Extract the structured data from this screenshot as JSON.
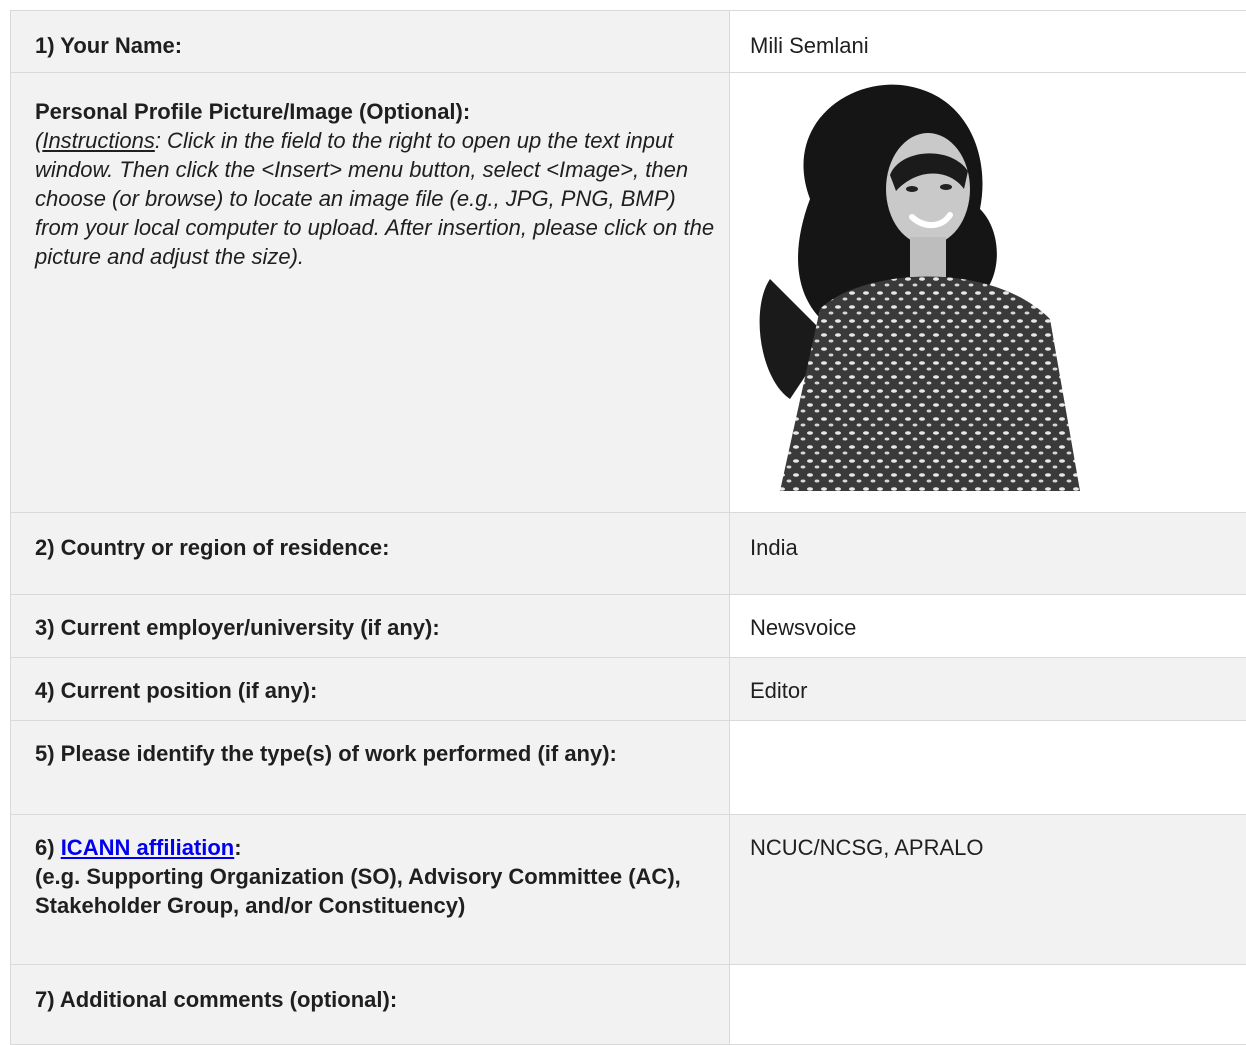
{
  "rows": {
    "name": {
      "question": "1) Your Name:",
      "answer": "Mili Semlani"
    },
    "picture": {
      "question": "Personal Profile Picture/Image (Optional):",
      "instructions_open": "(",
      "instructions_lead": "Instructions",
      "instructions_body": ": Click in the field to the right to open up the text input window. Then click the <Insert> menu button, select <Image>, then choose (or browse) to locate an image file (e.g., JPG, PNG, BMP) from your local computer to upload. After insertion, please click on the picture and adjust the size)."
    },
    "country": {
      "question": "2) Country or region of residence:",
      "answer": "India"
    },
    "employer": {
      "question": "3) Current employer/university (if any):",
      "answer": "Newsvoice"
    },
    "position": {
      "question": "4) Current position (if any):",
      "answer": "Editor"
    },
    "work": {
      "question": "5) Please identify the type(s) of work performed (if any):",
      "answer": ""
    },
    "affiliation": {
      "number": "6) ",
      "link_text": "ICANN affiliation",
      "colon": ":",
      "detail": "(e.g. Supporting Organization (SO), Advisory Committee (AC), Stakeholder Group, and/or Constituency)",
      "answer": "NCUC/NCSG, APRALO"
    },
    "comments": {
      "question": "7) Additional comments (optional):",
      "answer": ""
    }
  },
  "colors": {
    "label_background": "#f2f2f2",
    "border": "#d9d9d9",
    "link": "#0000ee"
  }
}
